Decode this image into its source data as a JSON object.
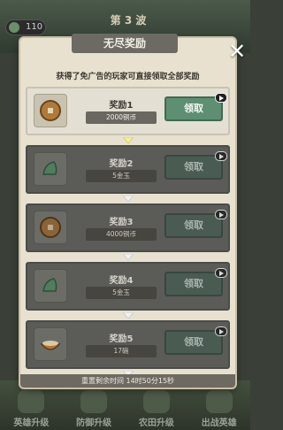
{
  "hud": {
    "wave_label": "第 3 波",
    "counter": "110"
  },
  "modal": {
    "title": "无尽奖励",
    "subtitle": "获得了免广告的玩家可直接领取全部奖励",
    "close_symbol": "✕",
    "timer_label": "重置剩余时间 14时50分15秒"
  },
  "rewards": [
    {
      "name": "奖励1",
      "value": "2000铜币",
      "button": "领取",
      "state": "available",
      "icon": "copper-coin-icon"
    },
    {
      "name": "奖励2",
      "value": "5金玉",
      "button": "领取",
      "state": "locked",
      "icon": "jade-icon"
    },
    {
      "name": "奖励3",
      "value": "4000铜币",
      "button": "领取",
      "state": "locked",
      "icon": "copper-coin-icon"
    },
    {
      "name": "奖励4",
      "value": "5金玉",
      "button": "领取",
      "state": "locked",
      "icon": "jade-icon"
    },
    {
      "name": "奖励5",
      "value": "17碗",
      "button": "领取",
      "state": "locked",
      "icon": "bowl-icon"
    }
  ],
  "nav": [
    {
      "label": "英雄升级"
    },
    {
      "label": "防御升级"
    },
    {
      "label": "农田升级"
    },
    {
      "label": "出战英雄"
    }
  ],
  "colors": {
    "claim_green": "#5e8f72",
    "locked_gray": "#5b5b58",
    "panel_cream": "#e8e1d0"
  }
}
